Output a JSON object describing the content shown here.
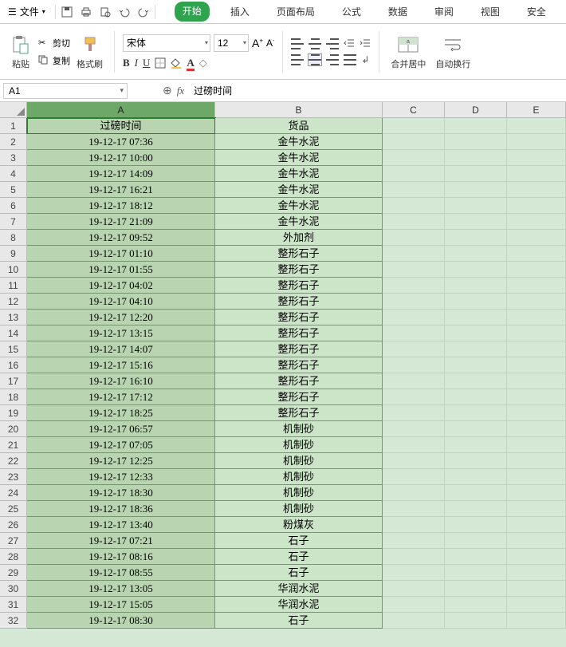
{
  "menu": {
    "file": "文件",
    "tabs": [
      "开始",
      "插入",
      "页面布局",
      "公式",
      "数据",
      "审阅",
      "视图",
      "安全"
    ],
    "active_tab": 0
  },
  "ribbon": {
    "paste": "粘贴",
    "cut": "剪切",
    "copy": "复制",
    "format_painter": "格式刷",
    "font_name": "宋体",
    "font_size": "12",
    "bold": "B",
    "italic": "I",
    "underline": "U",
    "merge_center": "合并居中",
    "auto_wrap": "自动换行"
  },
  "formula_bar": {
    "cell_ref": "A1",
    "fx": "fx",
    "content": "过磅时间"
  },
  "columns": [
    "A",
    "B",
    "C",
    "D",
    "E"
  ],
  "headers": {
    "A": "过磅时间",
    "B": "货品"
  },
  "rows": [
    {
      "n": 1,
      "A": "过磅时间",
      "B": "货品"
    },
    {
      "n": 2,
      "A": "19-12-17 07:36",
      "B": "金牛水泥"
    },
    {
      "n": 3,
      "A": "19-12-17 10:00",
      "B": "金牛水泥"
    },
    {
      "n": 4,
      "A": "19-12-17 14:09",
      "B": "金牛水泥"
    },
    {
      "n": 5,
      "A": "19-12-17 16:21",
      "B": "金牛水泥"
    },
    {
      "n": 6,
      "A": "19-12-17 18:12",
      "B": "金牛水泥"
    },
    {
      "n": 7,
      "A": "19-12-17 21:09",
      "B": "金牛水泥"
    },
    {
      "n": 8,
      "A": "19-12-17 09:52",
      "B": "外加剂"
    },
    {
      "n": 9,
      "A": "19-12-17 01:10",
      "B": "整形石子"
    },
    {
      "n": 10,
      "A": "19-12-17 01:55",
      "B": "整形石子"
    },
    {
      "n": 11,
      "A": "19-12-17 04:02",
      "B": "整形石子"
    },
    {
      "n": 12,
      "A": "19-12-17 04:10",
      "B": "整形石子"
    },
    {
      "n": 13,
      "A": "19-12-17 12:20",
      "B": "整形石子"
    },
    {
      "n": 14,
      "A": "19-12-17 13:15",
      "B": "整形石子"
    },
    {
      "n": 15,
      "A": "19-12-17 14:07",
      "B": "整形石子"
    },
    {
      "n": 16,
      "A": "19-12-17 15:16",
      "B": "整形石子"
    },
    {
      "n": 17,
      "A": "19-12-17 16:10",
      "B": "整形石子"
    },
    {
      "n": 18,
      "A": "19-12-17 17:12",
      "B": "整形石子"
    },
    {
      "n": 19,
      "A": "19-12-17 18:25",
      "B": "整形石子"
    },
    {
      "n": 20,
      "A": "19-12-17 06:57",
      "B": "机制砂"
    },
    {
      "n": 21,
      "A": "19-12-17 07:05",
      "B": "机制砂"
    },
    {
      "n": 22,
      "A": "19-12-17 12:25",
      "B": "机制砂"
    },
    {
      "n": 23,
      "A": "19-12-17 12:33",
      "B": "机制砂"
    },
    {
      "n": 24,
      "A": "19-12-17 18:30",
      "B": "机制砂"
    },
    {
      "n": 25,
      "A": "19-12-17 18:36",
      "B": "机制砂"
    },
    {
      "n": 26,
      "A": "19-12-17 13:40",
      "B": "粉煤灰"
    },
    {
      "n": 27,
      "A": "19-12-17 07:21",
      "B": "石子"
    },
    {
      "n": 28,
      "A": "19-12-17 08:16",
      "B": "石子"
    },
    {
      "n": 29,
      "A": "19-12-17 08:55",
      "B": "石子"
    },
    {
      "n": 30,
      "A": "19-12-17 13:05",
      "B": "华润水泥"
    },
    {
      "n": 31,
      "A": "19-12-17 15:05",
      "B": "华润水泥"
    },
    {
      "n": 32,
      "A": "19-12-17 08:30",
      "B": "石子"
    }
  ]
}
